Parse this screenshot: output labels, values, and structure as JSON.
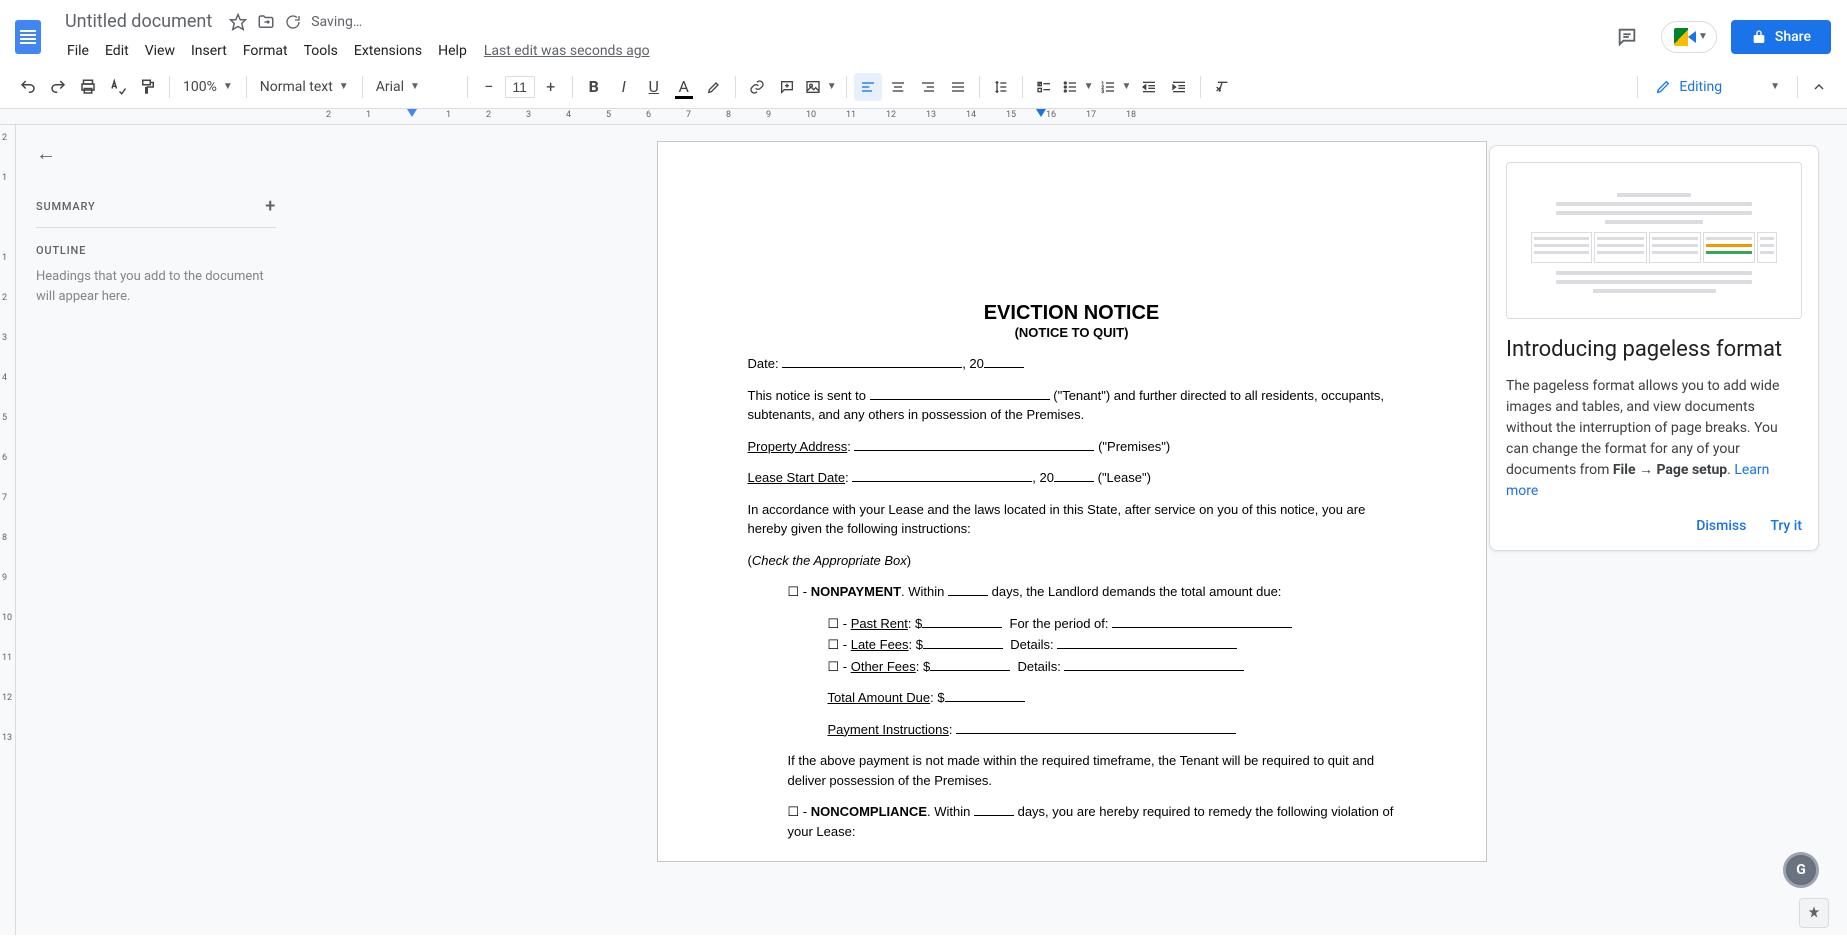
{
  "header": {
    "title": "Untitled document",
    "saving": "Saving…",
    "last_edit": "Last edit was seconds ago",
    "share": "Share"
  },
  "menus": [
    "File",
    "Edit",
    "View",
    "Insert",
    "Format",
    "Tools",
    "Extensions",
    "Help"
  ],
  "toolbar": {
    "zoom": "100%",
    "style": "Normal text",
    "font": "Arial",
    "font_size": "11",
    "mode": "Editing"
  },
  "ruler": {
    "ticks": [
      "2",
      "1",
      "",
      "1",
      "2",
      "3",
      "4",
      "5",
      "6",
      "7",
      "8",
      "9",
      "10",
      "11",
      "12",
      "13",
      "14",
      "15",
      "16",
      "17",
      "18"
    ]
  },
  "v_ruler": {
    "ticks": [
      "2",
      "1",
      "",
      "1",
      "2",
      "3",
      "4",
      "5",
      "6",
      "7",
      "8",
      "9",
      "10",
      "11",
      "12",
      "13"
    ]
  },
  "sidebar": {
    "summary": "SUMMARY",
    "outline": "OUTLINE",
    "outline_empty": "Headings that you add to the document will appear here."
  },
  "callout": {
    "title": "Introducing pageless format",
    "body_prefix": "The pageless format allows you to add wide images and tables, and view documents without the interruption of page breaks. You can change the format for any of your documents from ",
    "body_bold": "File → Page setup",
    "body_suffix": ". ",
    "learn_more": "Learn more",
    "dismiss": "Dismiss",
    "try_it": "Try it"
  },
  "doc": {
    "title": "EVICTION NOTICE",
    "subtitle": "(NOTICE TO QUIT)",
    "date_label": "Date:",
    "date_sep": ", 20",
    "tenant_line_1": "This notice is sent to",
    "tenant_line_2": "(\"Tenant\") and further directed to all residents, occupants, subtenants, and any others in possession of the Premises.",
    "prop_addr_label": "Property Address",
    "premises": "(\"Premises\")",
    "lease_start_label": "Lease Start Date",
    "lease_sep": ", 20",
    "lease_suffix": "(\"Lease\")",
    "accord": "In accordance with your Lease and the laws located in this State, after service on you of this notice, you are hereby given the following instructions:",
    "check_box": "Check the Appropriate Box",
    "nonpay_label": "NONPAYMENT",
    "nonpay_1": ". Within",
    "nonpay_2": "days, the Landlord demands the total amount due:",
    "past_rent": "Past Rent",
    "late_fees": "Late Fees",
    "other_fees": "Other Fees",
    "period_label": "For the period of:",
    "details_label": "Details:",
    "total_due": "Total Amount Due",
    "pay_instr": "Payment Instructions",
    "if_not_paid": "If the above payment is not made within the required timeframe, the Tenant will be required to quit and deliver possession of the Premises.",
    "noncomp_label": "NONCOMPLIANCE",
    "noncomp_1": ". Within",
    "noncomp_2": "days, you are hereby required to remedy the following violation of your Lease:"
  }
}
